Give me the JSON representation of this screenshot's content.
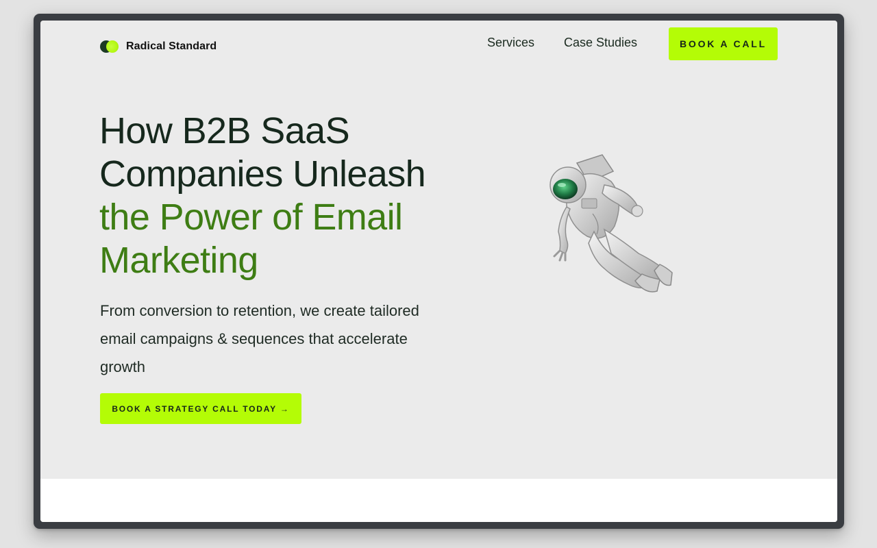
{
  "brand": {
    "name": "Radical Standard",
    "accent": "#b4fc06",
    "dark": "#16281d",
    "green": "#3e7d14"
  },
  "nav": {
    "links": [
      "Services",
      "Case Studies"
    ],
    "cta": "BOOK A CALL"
  },
  "hero": {
    "headline_dark": [
      "How B2B SaaS",
      "Companies Unleash"
    ],
    "headline_green": [
      "the Power of Email",
      "Marketing"
    ],
    "subtext": "From conversion to retention, we create tailored email campaigns & sequences that accelerate growth",
    "cta": "BOOK A STRATEGY CALL TODAY →",
    "image": "astronaut-illustration"
  }
}
